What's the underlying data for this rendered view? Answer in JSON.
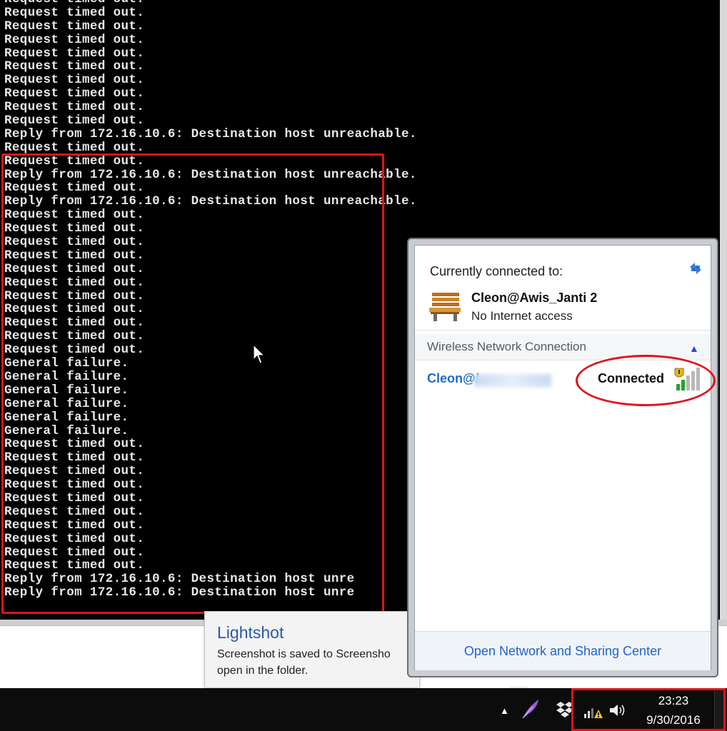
{
  "console": {
    "lines": [
      "Request timed out.",
      "Request timed out.",
      "Request timed out.",
      "Request timed out.",
      "Request timed out.",
      "Request timed out.",
      "Request timed out.",
      "Request timed out.",
      "Request timed out.",
      "Request timed out.",
      "Reply from 172.16.10.6: Destination host unreachable.",
      "Request timed out.",
      "Request timed out.",
      "Reply from 172.16.10.6: Destination host unreachable.",
      "Request timed out.",
      "Reply from 172.16.10.6: Destination host unreachable.",
      "Request timed out.",
      "Request timed out.",
      "Request timed out.",
      "Request timed out.",
      "Request timed out.",
      "Request timed out.",
      "Request timed out.",
      "Request timed out.",
      "Request timed out.",
      "Request timed out.",
      "Request timed out.",
      "General failure.",
      "General failure.",
      "General failure.",
      "General failure.",
      "General failure.",
      "General failure.",
      "Request timed out.",
      "Request timed out.",
      "Request timed out.",
      "Request timed out.",
      "Request timed out.",
      "Request timed out.",
      "Request timed out.",
      "Request timed out.",
      "Request timed out.",
      "Request timed out.",
      "Reply from 172.16.10.6: Destination host unre",
      "Reply from 172.16.10.6: Destination host unre"
    ]
  },
  "toast": {
    "title": "Lightshot",
    "body": "Screenshot is saved to Screensho open in the folder."
  },
  "network_flyout": {
    "currently_connected_label": "Currently connected to:",
    "connection_name": "Cleon@Awis_Janti 2",
    "connection_status": "No Internet access",
    "section_label": "Wireless Network Connection",
    "network_name_visible": "Cleon@/",
    "network_state": "Connected",
    "footer_link": "Open Network and Sharing Center"
  },
  "taskbar": {
    "time": "23:23",
    "date": "9/30/2016"
  },
  "colors": {
    "annotation_red": "#e0131b",
    "link_blue": "#1f63c8",
    "console_bg": "#000000",
    "console_text": "#e8e8e8"
  },
  "icons": [
    "mouse-pointer-icon",
    "refresh-icon",
    "bench-network-icon",
    "collapse-chevron-icon",
    "wifi-signal-warning-icon",
    "show-hidden-icons-arrow",
    "feather-icon",
    "dropbox-icon",
    "network-warning-icon",
    "volume-icon"
  ]
}
